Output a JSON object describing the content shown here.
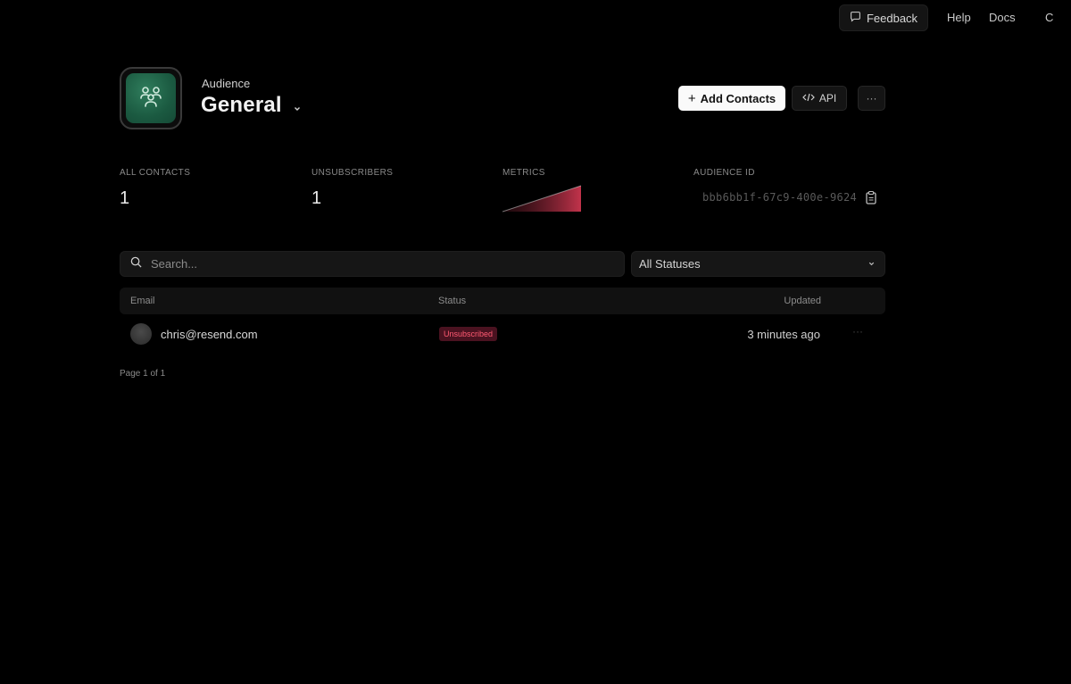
{
  "topnav": {
    "feedback_label": "Feedback",
    "help_label": "Help",
    "docs_label": "Docs",
    "account_initial": "C"
  },
  "audience": {
    "label": "Audience",
    "name": "General",
    "icon": "users-group-icon",
    "accent_color": "#1f6b4c"
  },
  "actions": {
    "add_contacts_label": "Add Contacts",
    "api_label": "API",
    "more_label": "···"
  },
  "stats": {
    "all_contacts": {
      "label": "ALL CONTACTS",
      "value": "1"
    },
    "unsubscribers": {
      "label": "UNSUBSCRIBERS",
      "value": "1"
    },
    "metrics": {
      "label": "METRICS",
      "color": "#e8445a"
    },
    "audience_id": {
      "label": "AUDIENCE ID",
      "value": "bbb6bb1f-67c9-400e-9624"
    }
  },
  "filters": {
    "search_placeholder": "Search...",
    "status_value": "All Statuses"
  },
  "table": {
    "headers": {
      "email": "Email",
      "status": "Status",
      "updated": "Updated"
    },
    "rows": [
      {
        "email": "chris@resend.com",
        "status": "Unsubscribed",
        "status_color": "#ff5a72",
        "updated": "3 minutes ago"
      }
    ]
  },
  "pagination": {
    "text": "Page 1 of 1"
  }
}
